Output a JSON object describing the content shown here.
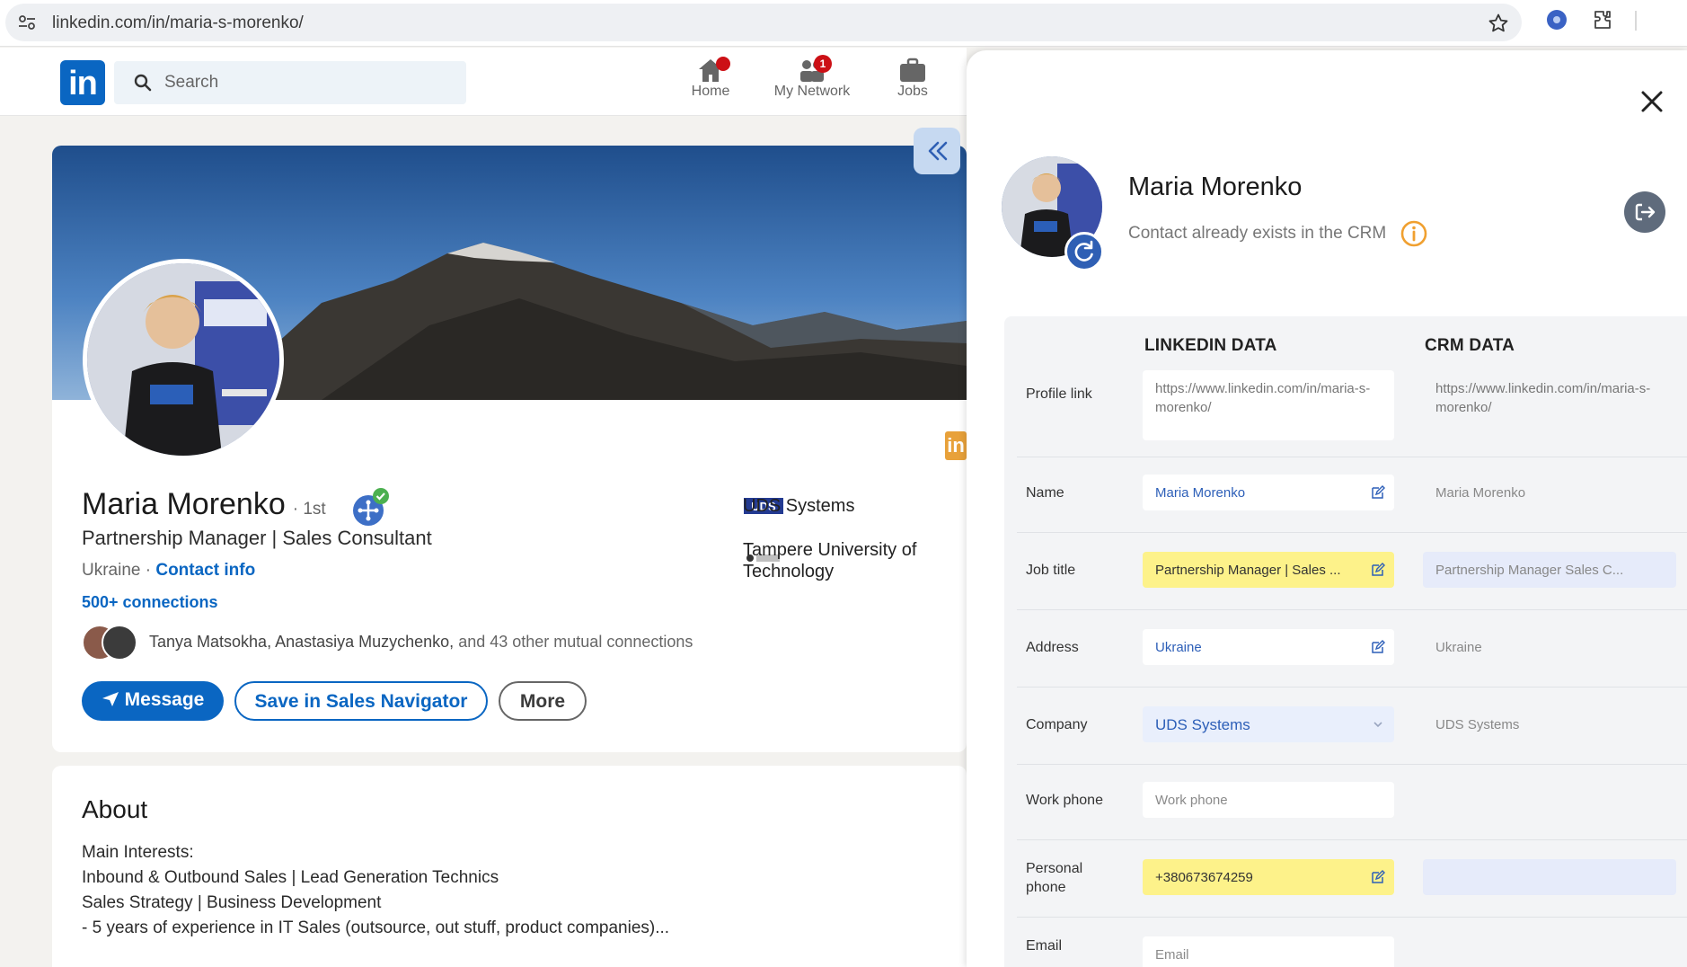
{
  "browser": {
    "url": "linkedin.com/in/maria-s-morenko/"
  },
  "linkedin": {
    "logo_text": "in",
    "search_placeholder": "Search",
    "nav": [
      {
        "label": "Home",
        "badge": ""
      },
      {
        "label": "My Network",
        "badge": "1"
      },
      {
        "label": "Jobs",
        "badge": ""
      }
    ]
  },
  "profile": {
    "name": "Maria Morenko",
    "degree": "· 1st",
    "headline": "Partnership Manager | Sales Consultant",
    "location": "Ukraine ·",
    "contact_info": "Contact info",
    "connections": "500+ connections",
    "mutual_names": "Tanya Matsokha, Anastasiya Muzychenko,",
    "mutual_rest": "and 43 other mutual connections",
    "buttons": {
      "message": "Message",
      "save_sales_nav": "Save in Sales Navigator",
      "more": "More"
    },
    "experience": [
      {
        "name": "UDS Systems"
      },
      {
        "name": "Tampere University of Technology"
      }
    ],
    "side_tag": "in"
  },
  "about": {
    "title": "About",
    "lines": [
      "Main Interests:",
      "Inbound & Outbound Sales | Lead Generation Technics",
      "Sales Strategy | Business Development",
      "- 5 years of experience in IT Sales (outsource, out stuff, product companies)..."
    ]
  },
  "crm_panel": {
    "name": "Maria Morenko",
    "status": "Contact already exists in the CRM",
    "col_linkedin": "LINKEDIN DATA",
    "col_crm": "CRM DATA",
    "rows": {
      "profile_link": {
        "label": "Profile link",
        "linkedin": "https://www.linkedin.com/in/maria-s-morenko/",
        "crm": "https://www.linkedin.com/in/maria-s-morenko/"
      },
      "name": {
        "label": "Name",
        "linkedin": "Maria Morenko",
        "crm": "Maria Morenko"
      },
      "job_title": {
        "label": "Job title",
        "linkedin": "Partnership Manager | Sales ...",
        "crm": "Partnership Manager Sales C..."
      },
      "address": {
        "label": "Address",
        "linkedin": "Ukraine",
        "crm": "Ukraine"
      },
      "company": {
        "label": "Company",
        "linkedin": "UDS Systems",
        "crm": "UDS Systems"
      },
      "work_phone": {
        "label": "Work phone",
        "placeholder": "Work phone"
      },
      "personal_phone": {
        "label": "Personal phone",
        "linkedin": "+380673674259",
        "crm": ""
      },
      "email": {
        "label": "Email",
        "placeholder": "Email"
      }
    }
  },
  "colors": {
    "linkedin_blue": "#0a66c2",
    "highlight_yellow": "#fdf28a",
    "crm_blue_cell": "#e6ebfa",
    "info_orange": "#f0a030",
    "badge_red": "#cc1016"
  }
}
